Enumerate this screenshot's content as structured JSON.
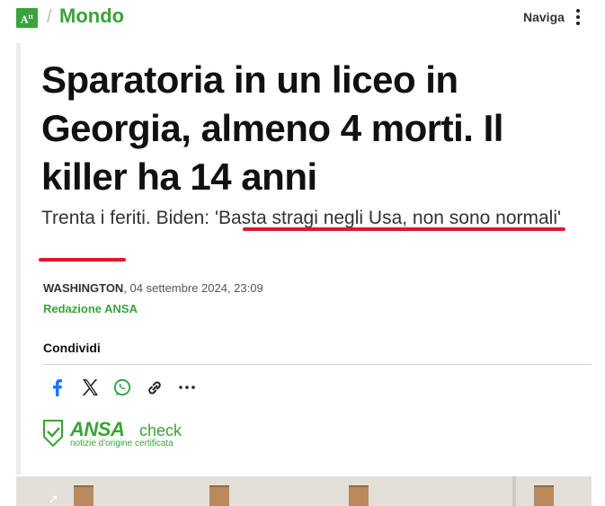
{
  "header": {
    "logo_text": "A",
    "separator": "/",
    "section": "Mondo",
    "nav_label": "Naviga"
  },
  "article": {
    "title": "Sparatoria in un liceo in Georgia, almeno 4 morti. Il killer ha 14 anni",
    "subtitle_plain": "Trenta i feriti. Biden: ",
    "subtitle_quote": "'Basta stragi negli Usa, non sono normali'",
    "location": "WASHINGTON",
    "date": ", 04 settembre 2024, 23:09",
    "author": "Redazione ANSA",
    "highlight_color": "#e0182d"
  },
  "share": {
    "label": "Condividi",
    "icons": [
      "facebook-icon",
      "x-icon",
      "whatsapp-icon",
      "link-icon",
      "more-icon"
    ]
  },
  "badge": {
    "brand": "ANSA",
    "suffix": "check",
    "tagline": "notizie d'origine certificata"
  },
  "colors": {
    "accent": "#3aa33a",
    "text": "#111111"
  }
}
